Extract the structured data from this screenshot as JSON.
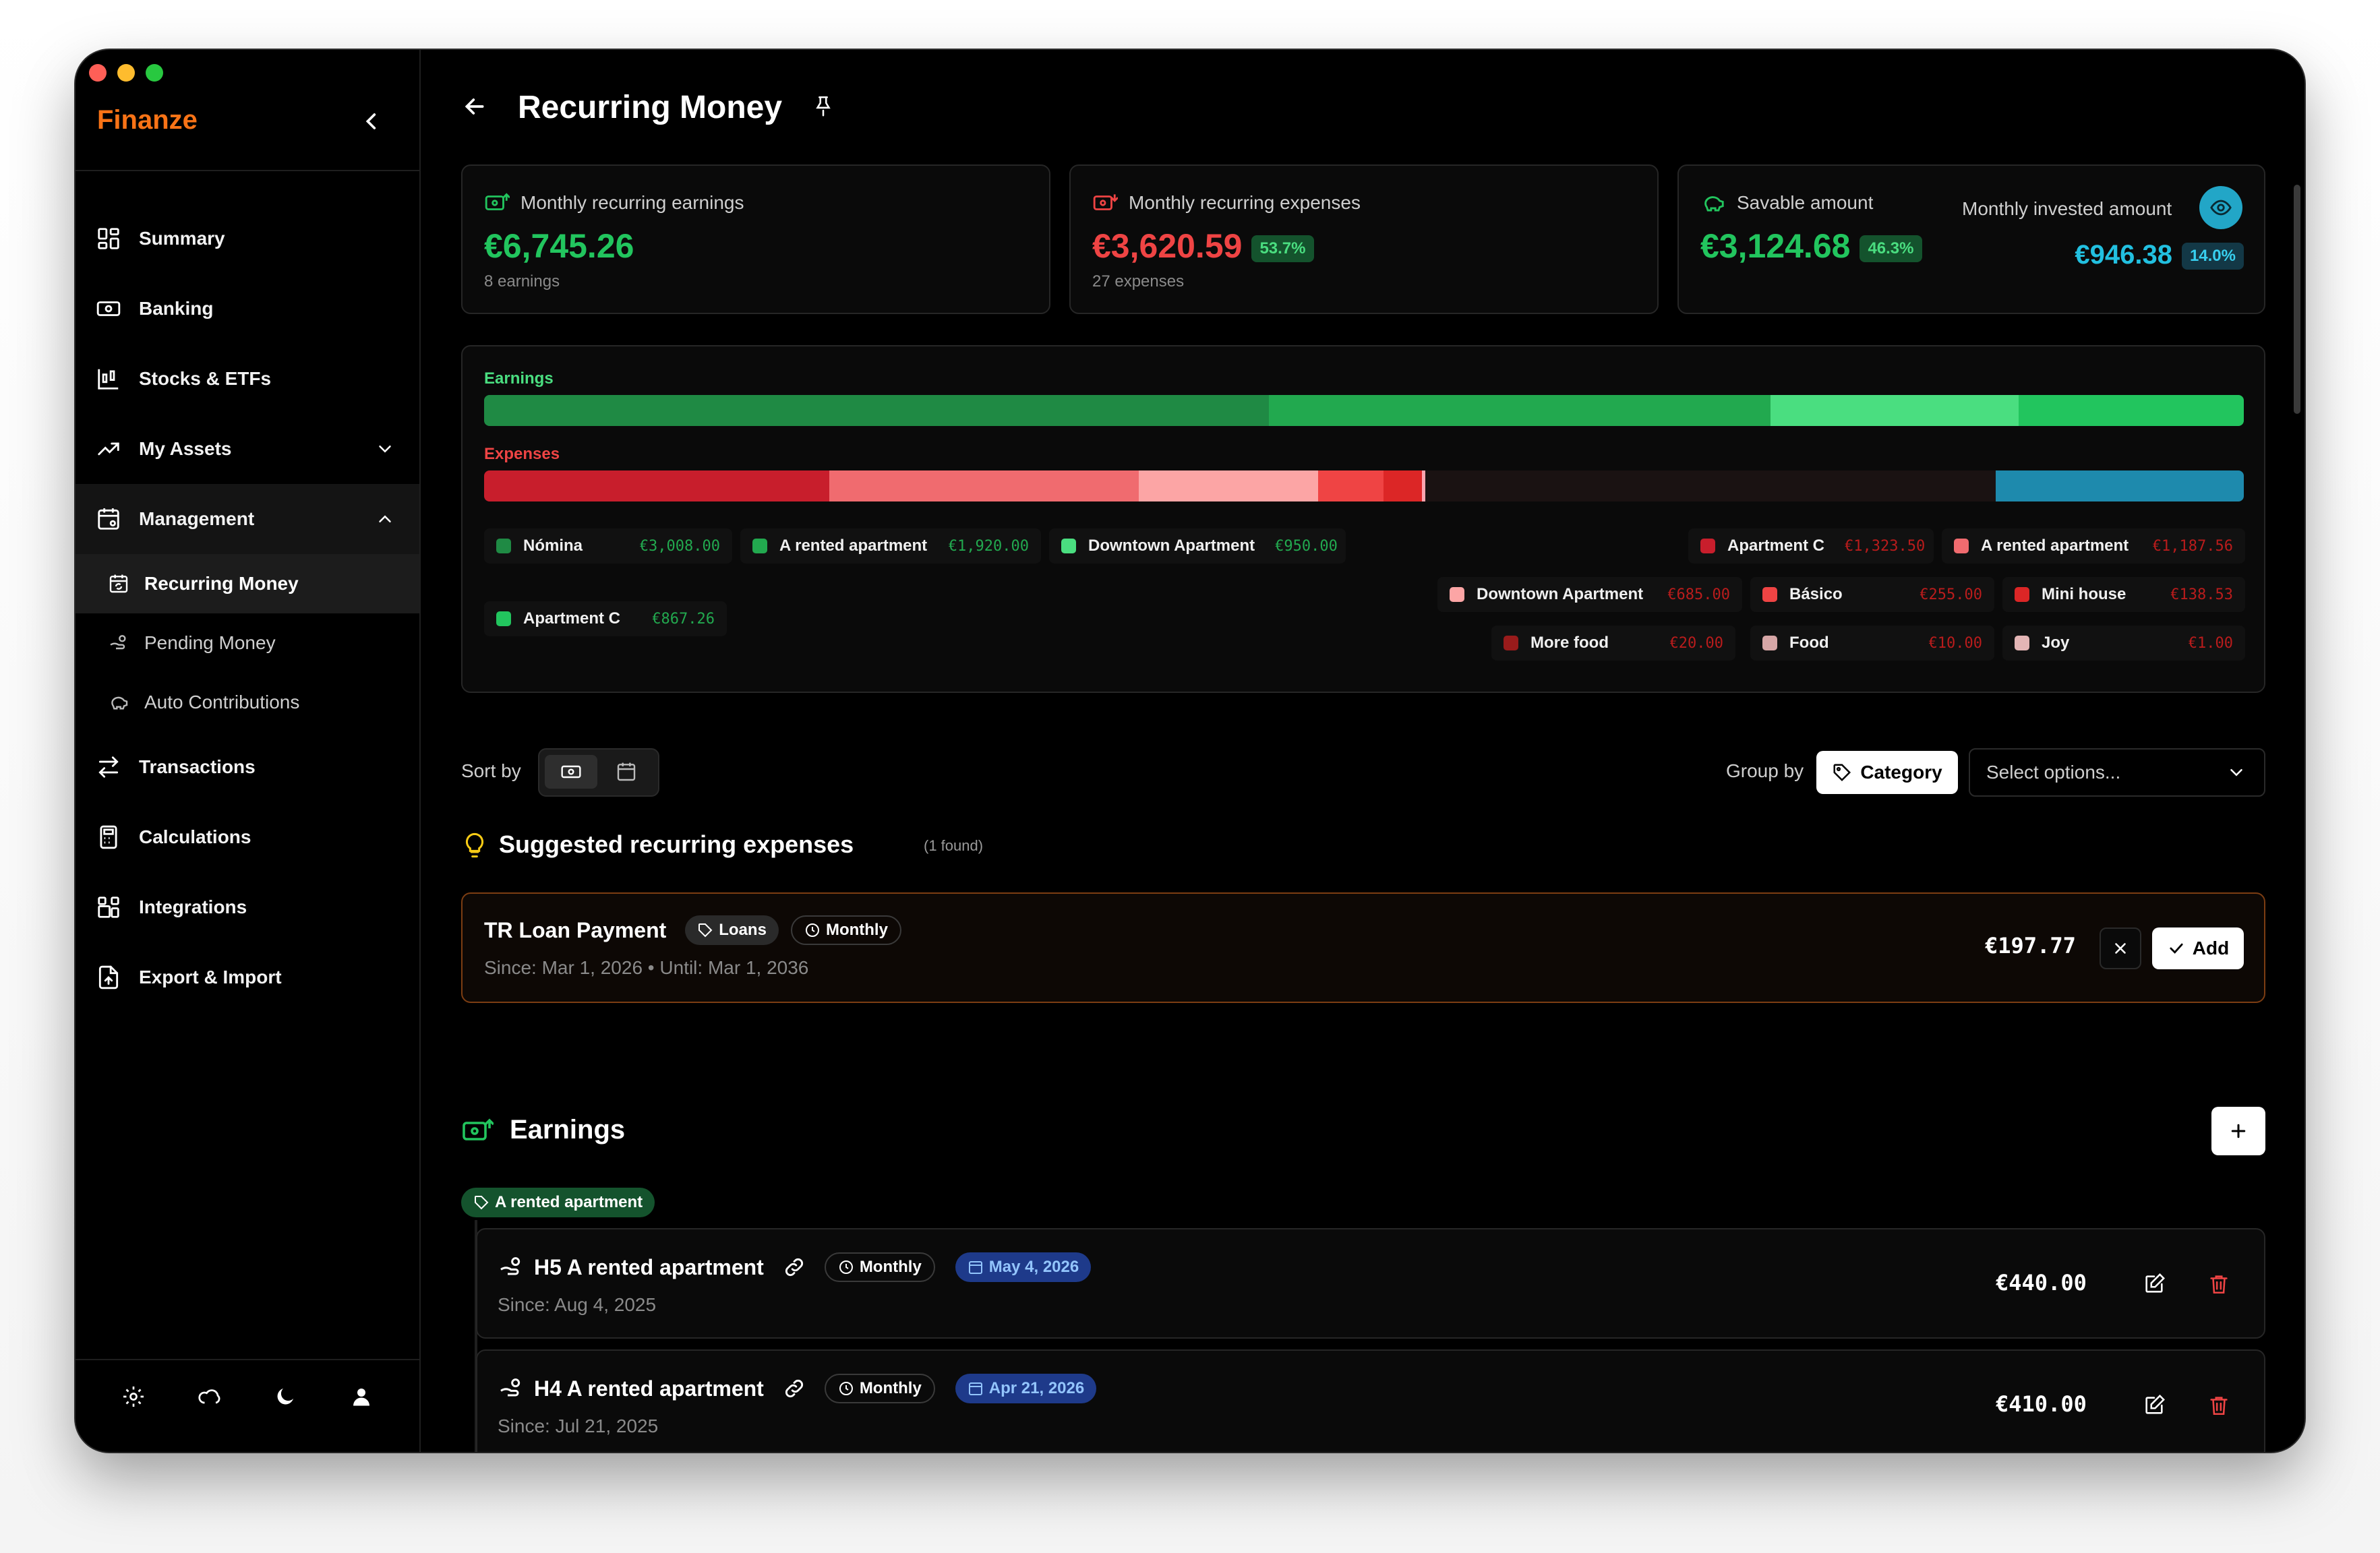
{
  "app": {
    "brand": "Finanze"
  },
  "sidebar": {
    "items": [
      {
        "label": "Summary"
      },
      {
        "label": "Banking"
      },
      {
        "label": "Stocks & ETFs"
      },
      {
        "label": "My Assets"
      },
      {
        "label": "Management"
      }
    ],
    "sub_items": [
      {
        "label": "Recurring Money"
      },
      {
        "label": "Pending Money"
      },
      {
        "label": "Auto Contributions"
      }
    ],
    "items_after": [
      {
        "label": "Transactions"
      },
      {
        "label": "Calculations"
      },
      {
        "label": "Integrations"
      },
      {
        "label": "Export & Import"
      }
    ]
  },
  "page": {
    "title": "Recurring Money"
  },
  "summary": {
    "earnings": {
      "label": "Monthly recurring earnings",
      "amount": "€6,745.26",
      "count": "8 earnings"
    },
    "expenses": {
      "label": "Monthly recurring expenses",
      "amount": "€3,620.59",
      "pct": "53.7%",
      "count": "27 expenses"
    },
    "savable": {
      "label": "Savable amount",
      "amount": "€3,124.68",
      "pct": "46.3%"
    },
    "invested": {
      "label": "Monthly invested amount",
      "amount": "€946.38",
      "pct": "14.0%"
    }
  },
  "breakdown": {
    "earnings_title": "Earnings",
    "expenses_title": "Expenses",
    "earnings_bar": [
      {
        "fraction": 0.446,
        "color": "#1f8a44"
      },
      {
        "fraction": 0.285,
        "color": "#22a94f"
      },
      {
        "fraction": 0.141,
        "color": "#4ade80"
      },
      {
        "fraction": 0.128,
        "color": "#22c55e"
      }
    ],
    "expenses_bar": [
      {
        "fraction": 0.196,
        "color": "#c81e2c"
      },
      {
        "fraction": 0.176,
        "color": "#f06b6f"
      },
      {
        "fraction": 0.102,
        "color": "#fca5a5"
      },
      {
        "fraction": 0.037,
        "color": "#ef4444"
      },
      {
        "fraction": 0.022,
        "color": "#dc2626"
      },
      {
        "fraction": 0.002,
        "color": "#fda4af"
      },
      {
        "fraction": 0.324,
        "color": "#1a1212"
      },
      {
        "fraction": 0.141,
        "color": "#1e8aad"
      }
    ],
    "earning_chips": [
      {
        "name": "Nómina",
        "amount": "€3,008.00",
        "color": "#1f8a44"
      },
      {
        "name": "A rented apartment",
        "amount": "€1,920.00",
        "color": "#22a94f"
      },
      {
        "name": "Downtown Apartment",
        "amount": "€950.00",
        "color": "#4ade80"
      },
      {
        "name": "Apartment C",
        "amount": "€867.26",
        "color": "#22c55e"
      }
    ],
    "expense_chips": [
      {
        "name": "Apartment C",
        "amount": "€1,323.50",
        "color": "#c81e2c"
      },
      {
        "name": "A rented apartment",
        "amount": "€1,187.56",
        "color": "#f06b6f"
      },
      {
        "name": "Downtown Apartment",
        "amount": "€685.00",
        "color": "#fca5a5"
      },
      {
        "name": "Básico",
        "amount": "€255.00",
        "color": "#ef4444"
      },
      {
        "name": "Mini house",
        "amount": "€138.53",
        "color": "#dc2626"
      },
      {
        "name": "More food",
        "amount": "€20.00",
        "color": "#991b1b"
      },
      {
        "name": "Food",
        "amount": "€10.00",
        "color": "#d6a6a6"
      },
      {
        "name": "Joy",
        "amount": "€1.00",
        "color": "#e3b5b5"
      }
    ]
  },
  "controls": {
    "sort_label": "Sort by",
    "group_label": "Group by",
    "group_value": "Category",
    "select_placeholder": "Select options..."
  },
  "suggested": {
    "title": "Suggested recurring expenses",
    "found": "(1 found)",
    "item": {
      "name": "TR Loan Payment",
      "category": "Loans",
      "frequency": "Monthly",
      "dates": "Since: Mar 1, 2026 • Until: Mar 1, 2036",
      "amount": "€197.77",
      "add_label": "Add"
    }
  },
  "earnings_section": {
    "title": "Earnings",
    "group_tag": "A rented apartment",
    "rows": [
      {
        "name": "H5 A rented apartment",
        "frequency": "Monthly",
        "next_date": "May 4, 2026",
        "since": "Since: Aug 4, 2025",
        "amount": "€440.00"
      },
      {
        "name": "H4 A rented apartment",
        "frequency": "Monthly",
        "next_date": "Apr 21, 2026",
        "since": "Since: Jul 21, 2025",
        "amount": "€410.00"
      }
    ]
  }
}
